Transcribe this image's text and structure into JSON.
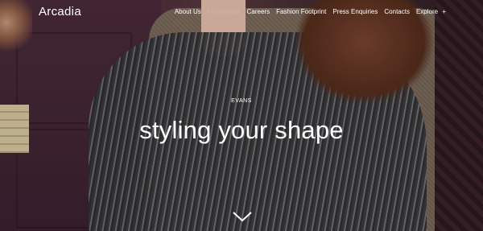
{
  "header": {
    "logo": "Arcadia",
    "nav": [
      {
        "label": "About Us",
        "active": false
      },
      {
        "label": "Our Brands",
        "active": true
      },
      {
        "label": "Careers",
        "active": false
      },
      {
        "label": "Fashion Footprint",
        "active": false
      },
      {
        "label": "Press Enquiries",
        "active": false
      },
      {
        "label": "Contacts",
        "active": false
      },
      {
        "label": "Explore",
        "active": false
      }
    ],
    "explore_icon": "plus-icon",
    "active_color": "#c8b6a8"
  },
  "hero": {
    "eyebrow": "EVANS",
    "headline": "styling your shape",
    "scroll_icon": "chevron-down-icon"
  }
}
